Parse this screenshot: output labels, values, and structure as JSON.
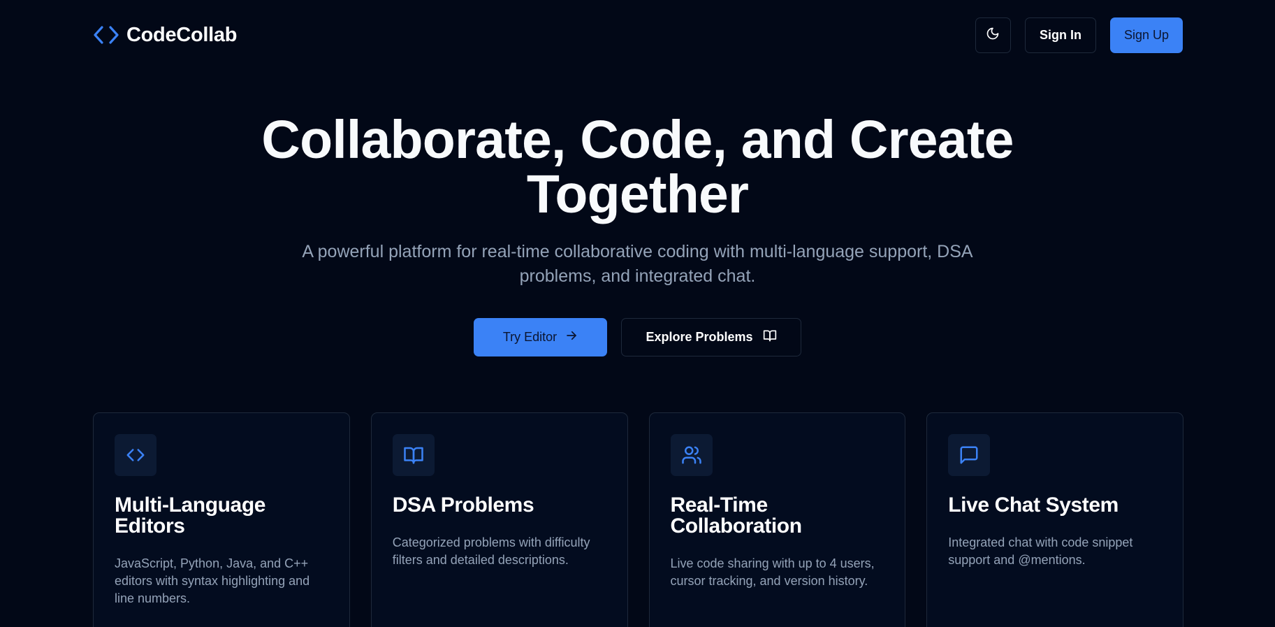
{
  "brand": {
    "name": "CodeCollab",
    "accent_color": "#3b82f6",
    "logo_icon": "code-brackets-icon"
  },
  "header": {
    "theme_toggle_icon": "moon-icon",
    "sign_in_label": "Sign In",
    "sign_up_label": "Sign Up"
  },
  "hero": {
    "title_line1": "Collaborate, Code, and Create",
    "title_line2": "Together",
    "subtitle_line1": "A powerful platform for real-time collaborative coding with multi-language support, DSA",
    "subtitle_line2": "problems, and integrated chat.",
    "primary_button": {
      "label": "Try Editor",
      "icon": "arrow-right-icon"
    },
    "secondary_button": {
      "label": "Explore Problems",
      "icon": "book-open-icon"
    }
  },
  "features": [
    {
      "icon": "code-brackets-icon",
      "title_line1": "Multi-Language",
      "title_line2": "Editors",
      "desc_line1": "JavaScript, Python, Java, and C++",
      "desc_line2": "editors with syntax highlighting and",
      "desc_line3": "line numbers."
    },
    {
      "icon": "book-open-icon",
      "title_line1": "DSA Problems",
      "desc_line1": "Categorized problems with difficulty",
      "desc_line2": "filters and detailed descriptions."
    },
    {
      "icon": "users-icon",
      "title_line1": "Real-Time",
      "title_line2": "Collaboration",
      "desc_line1": "Live code sharing with up to 4 users,",
      "desc_line2": "cursor tracking, and version history."
    },
    {
      "icon": "message-square-icon",
      "title_line1": "Live Chat System",
      "desc_line1": "Integrated chat with code snippet",
      "desc_line2": "support and @mentions."
    }
  ]
}
